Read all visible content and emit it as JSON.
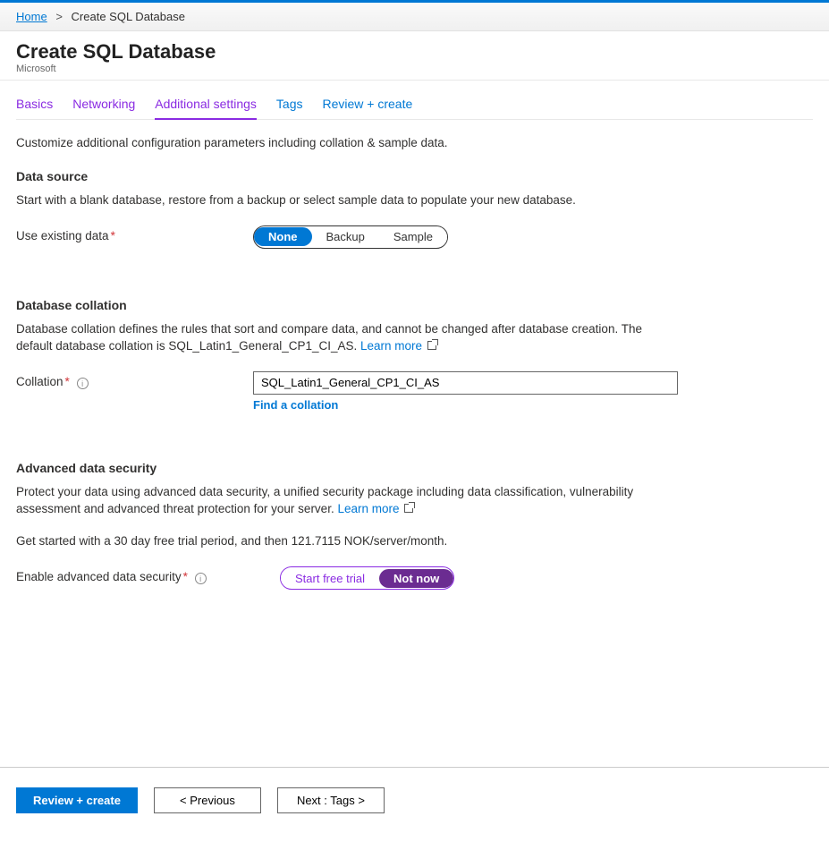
{
  "breadcrumb": {
    "home": "Home",
    "current": "Create SQL Database"
  },
  "header": {
    "title": "Create SQL Database",
    "subtitle": "Microsoft"
  },
  "tabs": {
    "basics": "Basics",
    "networking": "Networking",
    "additional": "Additional settings",
    "tags": "Tags",
    "review": "Review + create"
  },
  "intro": "Customize additional configuration parameters including collation & sample data.",
  "data_source": {
    "heading": "Data source",
    "desc": "Start with a blank database, restore from a backup or select sample data to populate your new database.",
    "label": "Use existing data",
    "options": {
      "none": "None",
      "backup": "Backup",
      "sample": "Sample"
    }
  },
  "collation": {
    "heading": "Database collation",
    "desc_1": "Database collation defines the rules that sort and compare data, and cannot be changed after database creation. The default database collation is SQL_Latin1_General_CP1_CI_AS. ",
    "learn_more": "Learn more",
    "label": "Collation",
    "value": "SQL_Latin1_General_CP1_CI_AS",
    "find": "Find a collation"
  },
  "ads": {
    "heading": "Advanced data security",
    "desc_1": "Protect your data using advanced data security, a unified security package including data classification, vulnerability assessment and advanced threat protection for your server. ",
    "learn_more": "Learn more",
    "trial_text": "Get started with a 30 day free trial period, and then 121.7115 NOK/server/month.",
    "label": "Enable advanced data security",
    "options": {
      "start": "Start free trial",
      "not_now": "Not now"
    }
  },
  "footer": {
    "review": "Review + create",
    "previous": "< Previous",
    "next": "Next : Tags >"
  }
}
